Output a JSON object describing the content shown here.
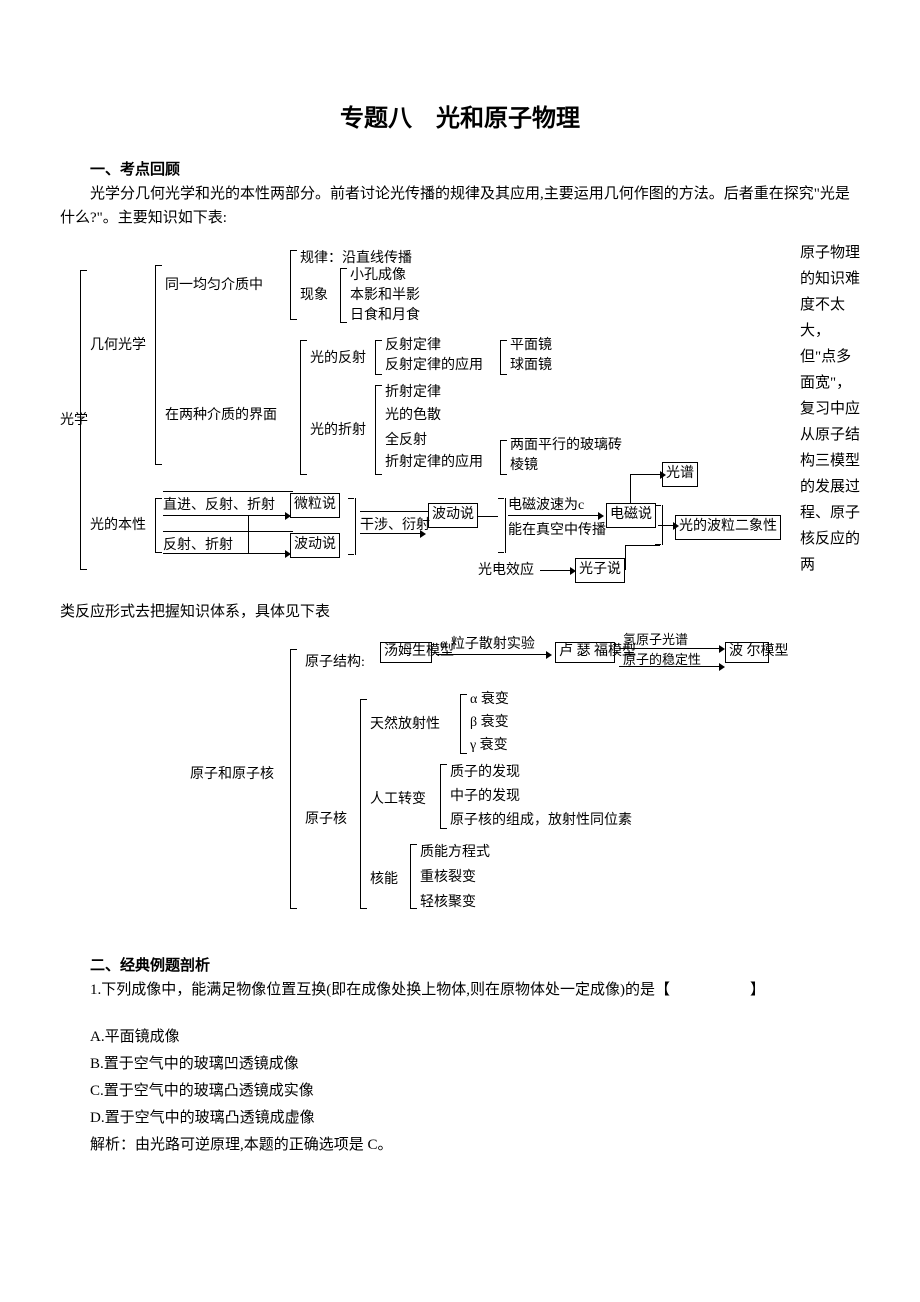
{
  "title": "专题八　光和原子物理",
  "section1": {
    "heading": "一、考点回顾",
    "p1": "光学分几何光学和光的本性两部分。前者讨论光传播的规律及其应用,主要运用几何作图的方法。后者重在探究\"光是什么?\"。主要知识如下表:",
    "right_text": "原子物理的知识难度不太大，但\"点多面宽\"，复习中应从原子结构三模型的发展过程、原子核反应的两",
    "bridge": "类反应形式去把握知识体系，具体见下表"
  },
  "tree": {
    "root": "光学",
    "geom": "几何光学",
    "medium_same": "同一均匀介质中",
    "medium_two": "在两种介质的界面",
    "rule": "规律：沿直线传播",
    "phenom": "现象",
    "pinhole": "小孔成像",
    "shadow": "本影和半影",
    "eclipse": "日食和月食",
    "reflect": "光的反射",
    "reflect_law": "反射定律",
    "reflect_app": "反射定律的应用",
    "plane_mirror": "平面镜",
    "sphere_mirror": "球面镜",
    "refract": "光的折射",
    "refract_law": "折射定律",
    "dispersion": "光的色散",
    "tir": "全反射",
    "refract_app": "折射定律的应用",
    "glass_slab": "两面平行的玻璃砖",
    "prism": "棱镜",
    "light_nature": "光的本性",
    "path1": "直进、反射、折射",
    "path2": "反射、折射",
    "particle": "微粒说",
    "wave": "波动说",
    "interference": "干涉、衍射",
    "wave2": "波动说",
    "em_speed": "电磁波速为c",
    "vacuum": "能在真空中传播",
    "em": "电磁说",
    "spectrum": "光谱",
    "photoelectric": "光电效应",
    "photon": "光子说",
    "duality": "光的波粒二象性"
  },
  "tree2": {
    "root": "原子和原子核",
    "atom_struct": "原子结构:",
    "thomson": "汤姆生模型",
    "alpha_exp": "α 粒子散射实验",
    "rutherford": "卢 瑟 福模型",
    "h_spectrum": "氢原子光谱",
    "stability": "原子的稳定性",
    "bohr": "波 尔模型",
    "nucleus": "原子核",
    "natural_rad": "天然放射性",
    "alpha_decay": "α 衰变",
    "beta_decay": "β 衰变",
    "gamma_decay": "γ 衰变",
    "artificial": "人工转变",
    "proton": "质子的发现",
    "neutron": "中子的发现",
    "composition": "原子核的组成，放射性同位素",
    "nuclear_energy": "核能",
    "mass_energy": "质能方程式",
    "fission": "重核裂变",
    "fusion": "轻核聚变"
  },
  "section2": {
    "heading": "二、经典例题剖析",
    "q1": "1.下列成像中，能满足物像位置互换(即在成像处换上物体,则在原物体处一定成像)的是【",
    "q1_end": "】",
    "optA": "A.平面镜成像",
    "optB": "B.置于空气中的玻璃凹透镜成像",
    "optC": "C.置于空气中的玻璃凸透镜成实像",
    "optD": "D.置于空气中的玻璃凸透镜成虚像",
    "analysis": "解析：由光路可逆原理,本题的正确选项是 C。"
  }
}
